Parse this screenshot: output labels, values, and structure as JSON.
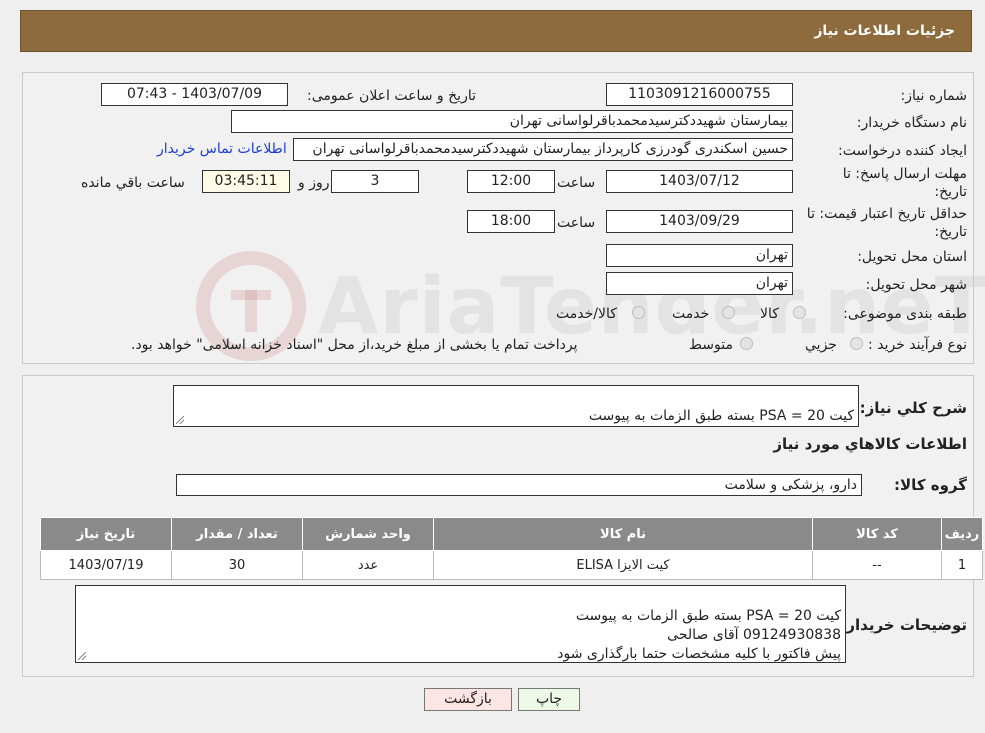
{
  "header": {
    "title": "جزئیات اطلاعات نیاز"
  },
  "watermark": {
    "text": "AriaTender.neT"
  },
  "form": {
    "need_number_label": "شماره نیاز:",
    "need_number": "1103091216000755",
    "announce_label": "تاریخ و ساعت اعلان عمومی:",
    "announce_value": "1403/07/09 - 07:43",
    "buyer_org_label": "نام دستگاه خریدار:",
    "buyer_org": "بیمارستان شهیددکترسیدمحمدباقرلواسانی تهران",
    "requester_label": "ایجاد کننده درخواست:",
    "requester": "حسین اسکندری گودرزی کارپرداز بیمارستان شهیددکترسیدمحمدباقرلواسانی تهران",
    "contact_link": "اطلاعات تماس خریدار",
    "reply_deadline_label_1": "مهلت ارسال پاسخ: تا",
    "reply_deadline_label_2": "تاریخ:",
    "reply_date": "1403/07/12",
    "time_label": "ساعت",
    "reply_time": "12:00",
    "days": "3",
    "days_label": "روز و",
    "remaining_time": "03:45:11",
    "remaining_label": "ساعت باقي مانده",
    "validity_label_1": "حداقل تاریخ اعتبار قیمت: تا",
    "validity_label_2": "تاریخ:",
    "validity_date": "1403/09/29",
    "validity_time": "18:00",
    "province_label": "استان محل تحویل:",
    "province": "تهران",
    "city_label": "شهر محل تحویل:",
    "city": "تهران",
    "category_label": "طبقه بندی موضوعی:",
    "category_options": [
      "کالا",
      "خدمت",
      "کالا/خدمت"
    ],
    "process_label": "نوع فرآیند خرید :",
    "process_options": [
      "جزیي",
      "متوسط"
    ],
    "process_note": "پرداخت تمام یا بخشی از مبلغ خرید،از محل \"اسناد خزانه اسلامی\" خواهد بود."
  },
  "details": {
    "summary_label": "شرح کلي نیاز:",
    "summary": "کیت PSA = 20 بسته طبق الزمات به پیوست",
    "goods_info_title": "اطلاعات کالاهاي مورد نیاز",
    "goods_group_label": "گروه کالا:",
    "goods_group": "دارو، پزشکی و سلامت",
    "table": {
      "headers": [
        "ردیف",
        "کد کالا",
        "نام کالا",
        "واحد شمارش",
        "تعداد / مقدار",
        "تاریخ نیاز"
      ],
      "rows": [
        [
          "1",
          "--",
          "کیت الایزا ELISA",
          "عدد",
          "30",
          "1403/07/19"
        ]
      ]
    },
    "buyer_notes_label": "توضیحات خریدار:",
    "buyer_notes": "کیت PSA = 20 بسته طبق الزمات به پیوست\n09124930838 آقای صالحی\nپیش فاکتور با کلیه مشخصات حتما بارگذاری شود"
  },
  "buttons": {
    "print": "چاپ",
    "back": "بازگشت"
  },
  "colors": {
    "header_bg": "#8d6b3d",
    "link": "#1a3fd6",
    "table_header": "#8a8a8a",
    "back_button": "#fde5e5",
    "print_button": "#eef8e6"
  }
}
